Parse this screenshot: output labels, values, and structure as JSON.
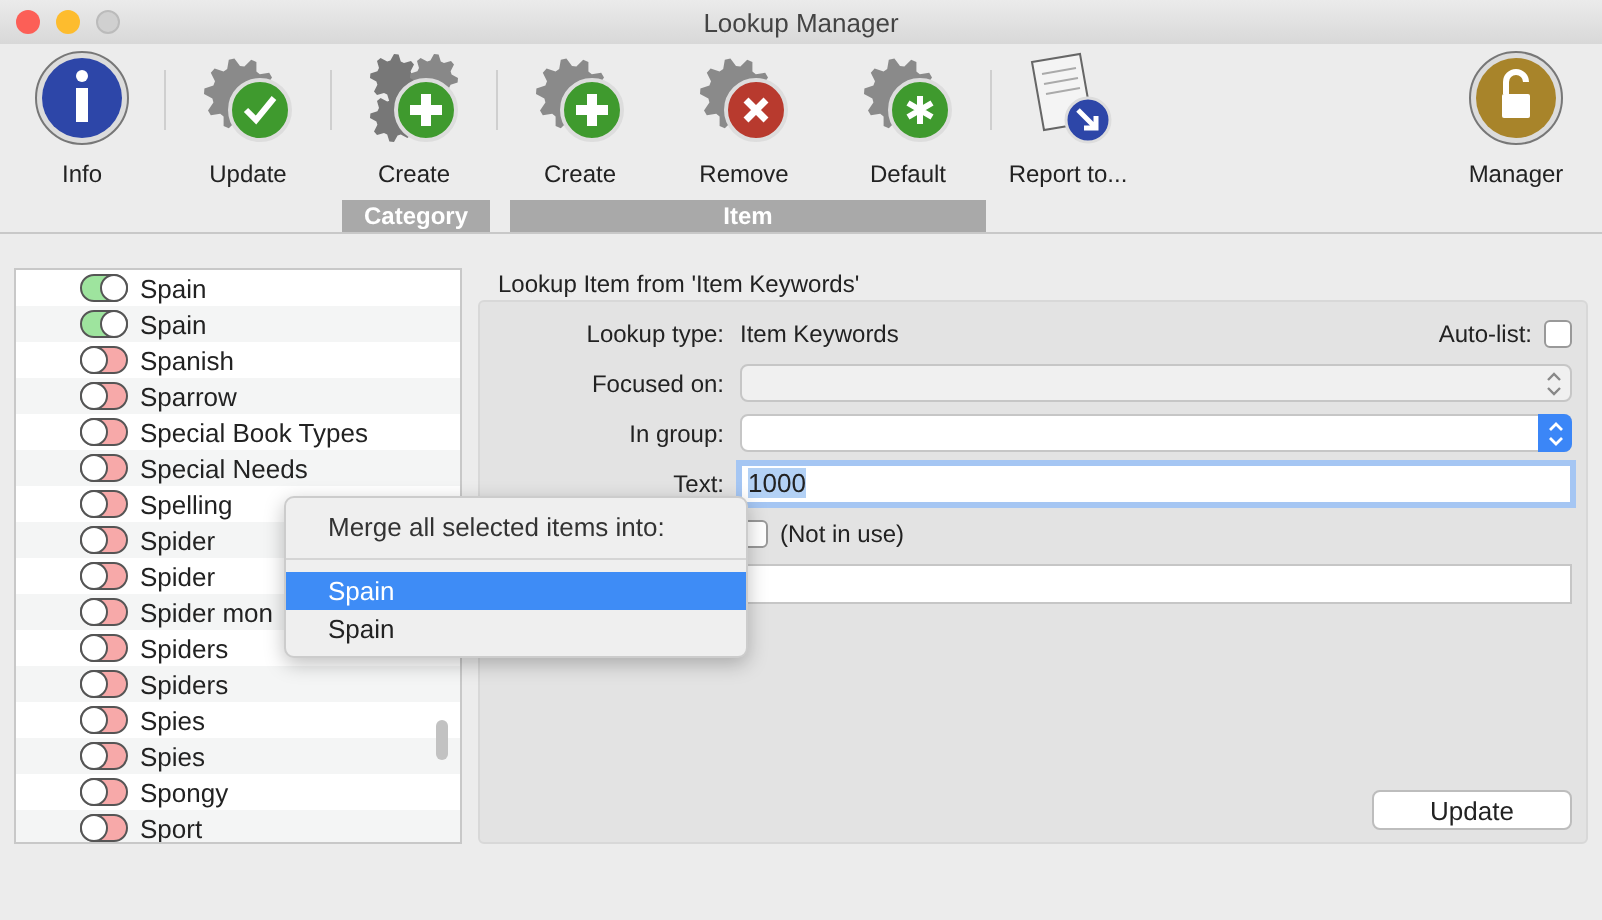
{
  "window": {
    "title": "Lookup Manager"
  },
  "toolbar": [
    {
      "label": "Info",
      "kind": "info"
    },
    {
      "label": "Update",
      "kind": "update"
    },
    {
      "label": "Create",
      "kind": "create-category"
    },
    {
      "label": "Create",
      "kind": "create"
    },
    {
      "label": "Remove",
      "kind": "remove"
    },
    {
      "label": "Default",
      "kind": "default"
    },
    {
      "label": "Report to...",
      "kind": "report"
    },
    {
      "label": "Manager",
      "kind": "manager"
    }
  ],
  "toolbar_groups": [
    {
      "label": "Category"
    },
    {
      "label": "Item"
    }
  ],
  "list": {
    "items": [
      {
        "label": "Spain",
        "on": true
      },
      {
        "label": "Spain",
        "on": true
      },
      {
        "label": "Spanish",
        "on": false
      },
      {
        "label": "Sparrow",
        "on": false
      },
      {
        "label": "Special Book Types",
        "on": false
      },
      {
        "label": "Special Needs",
        "on": false
      },
      {
        "label": "Spelling",
        "on": false
      },
      {
        "label": "Spider",
        "on": false
      },
      {
        "label": "Spider",
        "on": false
      },
      {
        "label": "Spider mon",
        "on": false
      },
      {
        "label": "Spiders",
        "on": false
      },
      {
        "label": "Spiders",
        "on": false
      },
      {
        "label": "Spies",
        "on": false
      },
      {
        "label": "Spies",
        "on": false
      },
      {
        "label": "Spongy",
        "on": false
      },
      {
        "label": "Sport",
        "on": false
      }
    ]
  },
  "panel": {
    "title": "Lookup Item from 'Item Keywords'",
    "lookup_type_label": "Lookup type:",
    "lookup_type": "Item Keywords",
    "auto_list_label": "Auto-list:",
    "auto_list_checked": false,
    "focused_on_label": "Focused on:",
    "focused_on_disabled": true,
    "in_group_label": "In group:",
    "text_label": "Text:",
    "text_value": "1000",
    "not_in_use_label": "(Not in use)",
    "not_in_use_checked": false,
    "update_button": "Update"
  },
  "menu": {
    "title": "Merge all selected items into:",
    "items": [
      {
        "label": "Spain",
        "selected": true
      },
      {
        "label": "Spain",
        "selected": false
      }
    ]
  }
}
